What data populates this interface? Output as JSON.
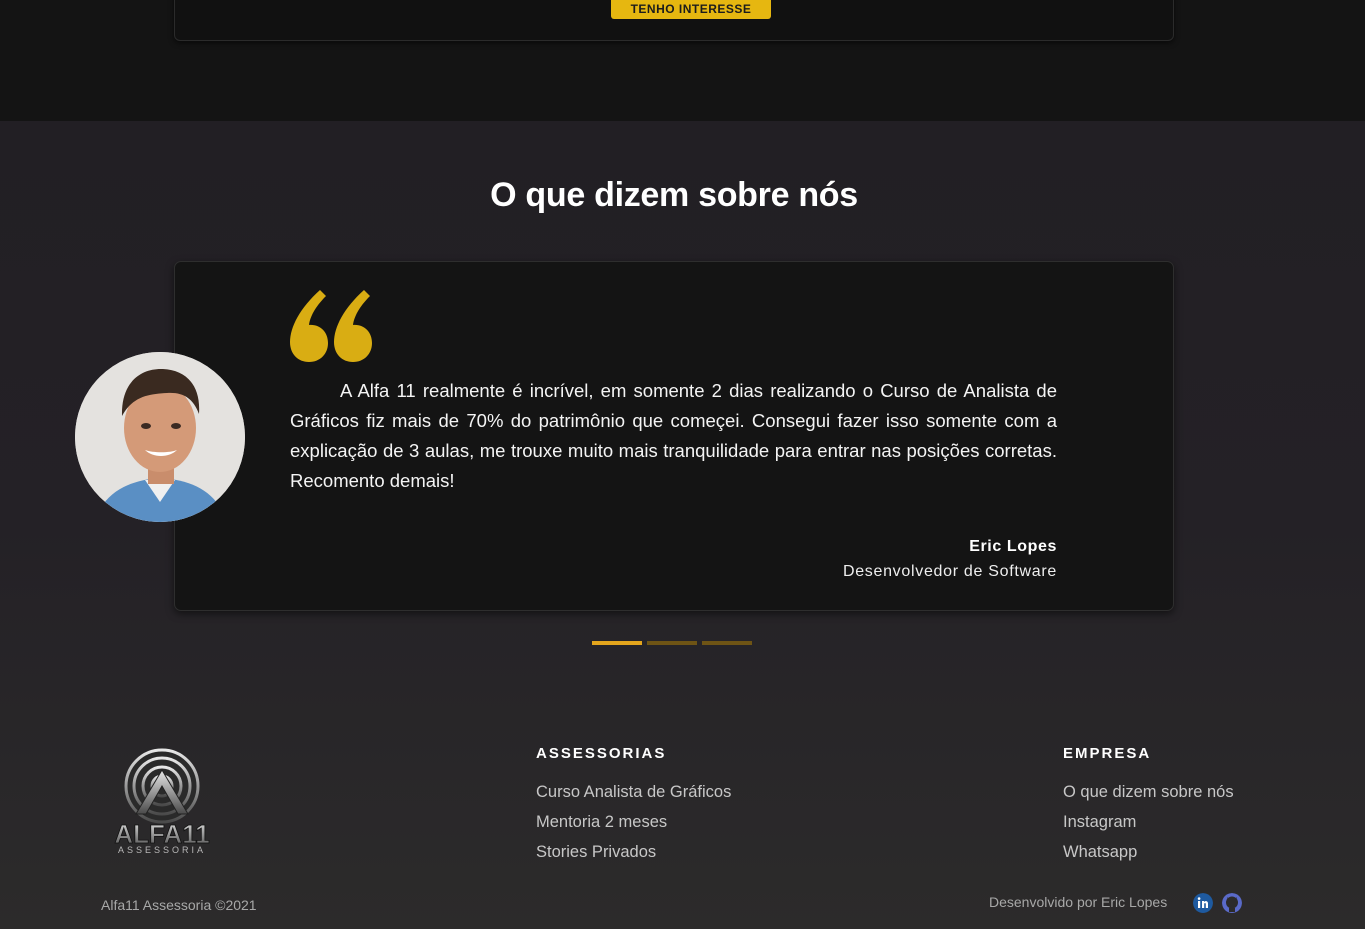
{
  "top": {
    "cta_label": "TENHO INTERESSE"
  },
  "testimonials": {
    "title": "O que dizem sobre nós",
    "text": "A Alfa 11 realmente é incrível, em somente 2 dias realizando o Curso de Analista de Gráficos fiz mais de 70% do patrimônio que começei. Consegui fazer isso somente com a explicação de 3 aulas, me trouxe muito mais tranquilidade para entrar nas posições corretas. Recomento demais!",
    "author_name": "Eric Lopes",
    "author_role": "Desenvolvedor de Software",
    "slides_total": 3,
    "active_slide": 1
  },
  "footer": {
    "logo_text": "ALFA11",
    "logo_subtext": "ASSESSORIA",
    "col1_heading": "ASSESSORIAS",
    "col1_links": [
      "Curso Analista de Gráficos",
      "Mentoria 2 meses",
      "Stories Privados"
    ],
    "col2_heading": "EMPRESA",
    "col2_links": [
      "O que dizem sobre nós",
      "Instagram",
      "Whatsapp"
    ],
    "copyright": "Alfa11 Assessoria ©2021",
    "credits": "Desenvolvido por Eric Lopes"
  },
  "colors": {
    "accent": "#e6b710",
    "indicator_active": "#e3a51d",
    "indicator_inactive": "#6e5415",
    "quote": "#d9ad13"
  },
  "icons": [
    "quote-icon",
    "linkedin-icon",
    "github-icon"
  ]
}
